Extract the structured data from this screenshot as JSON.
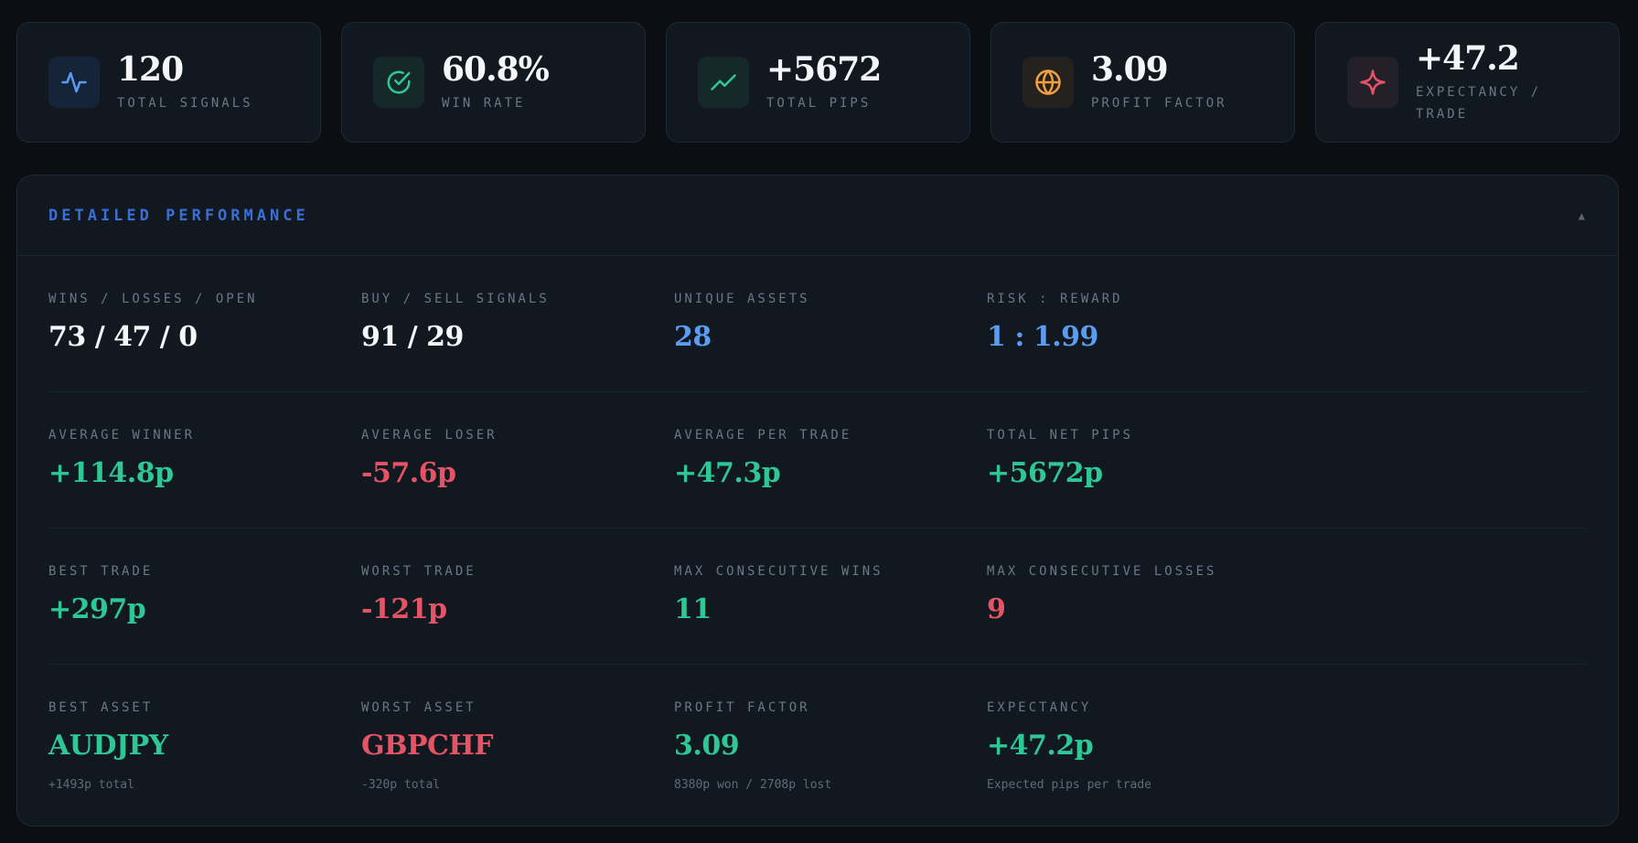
{
  "stats": [
    {
      "value": "120",
      "label": "TOTAL SIGNALS",
      "icon": "activity-icon",
      "color": "#5b9cf0",
      "bg": "#16243a"
    },
    {
      "value": "60.8%",
      "label": "WIN RATE",
      "icon": "check-circle-icon",
      "color": "#2fc795",
      "bg": "#16292a"
    },
    {
      "value": "+5672",
      "label": "TOTAL PIPS",
      "icon": "trending-up-icon",
      "color": "#2fc795",
      "bg": "#16292a"
    },
    {
      "value": "3.09",
      "label": "PROFIT FACTOR",
      "icon": "globe-icon",
      "color": "#f0a040",
      "bg": "#24211e"
    },
    {
      "value": "+47.2",
      "label": "EXPECTANCY / TRADE",
      "icon": "sparkle-icon",
      "color": "#e55466",
      "bg": "#24202a"
    }
  ],
  "panel": {
    "title": "DETAILED PERFORMANCE",
    "collapse_glyph": "▲",
    "rows": [
      [
        {
          "label": "WINS / LOSSES / OPEN",
          "value": "73 / 47 / 0",
          "color": "white"
        },
        {
          "label": "BUY / SELL SIGNALS",
          "value": "91 / 29",
          "color": "white"
        },
        {
          "label": "UNIQUE ASSETS",
          "value": "28",
          "color": "blue"
        },
        {
          "label": "RISK : REWARD",
          "value": "1 : 1.99",
          "color": "blue"
        }
      ],
      [
        {
          "label": "AVERAGE WINNER",
          "value": "+114.8p",
          "color": "green"
        },
        {
          "label": "AVERAGE LOSER",
          "value": "-57.6p",
          "color": "red"
        },
        {
          "label": "AVERAGE PER TRADE",
          "value": "+47.3p",
          "color": "green"
        },
        {
          "label": "TOTAL NET PIPS",
          "value": "+5672p",
          "color": "green"
        }
      ],
      [
        {
          "label": "BEST TRADE",
          "value": "+297p",
          "color": "green"
        },
        {
          "label": "WORST TRADE",
          "value": "-121p",
          "color": "red"
        },
        {
          "label": "MAX CONSECUTIVE WINS",
          "value": "11",
          "color": "green"
        },
        {
          "label": "MAX CONSECUTIVE LOSSES",
          "value": "9",
          "color": "red"
        }
      ],
      [
        {
          "label": "BEST ASSET",
          "value": "AUDJPY",
          "color": "green",
          "sub": "+1493p total"
        },
        {
          "label": "WORST ASSET",
          "value": "GBPCHF",
          "color": "red",
          "sub": "-320p total"
        },
        {
          "label": "PROFIT FACTOR",
          "value": "3.09",
          "color": "green",
          "sub": "8380p won / 2708p lost"
        },
        {
          "label": "EXPECTANCY",
          "value": "+47.2p",
          "color": "green",
          "sub": "Expected pips per trade"
        }
      ]
    ]
  }
}
